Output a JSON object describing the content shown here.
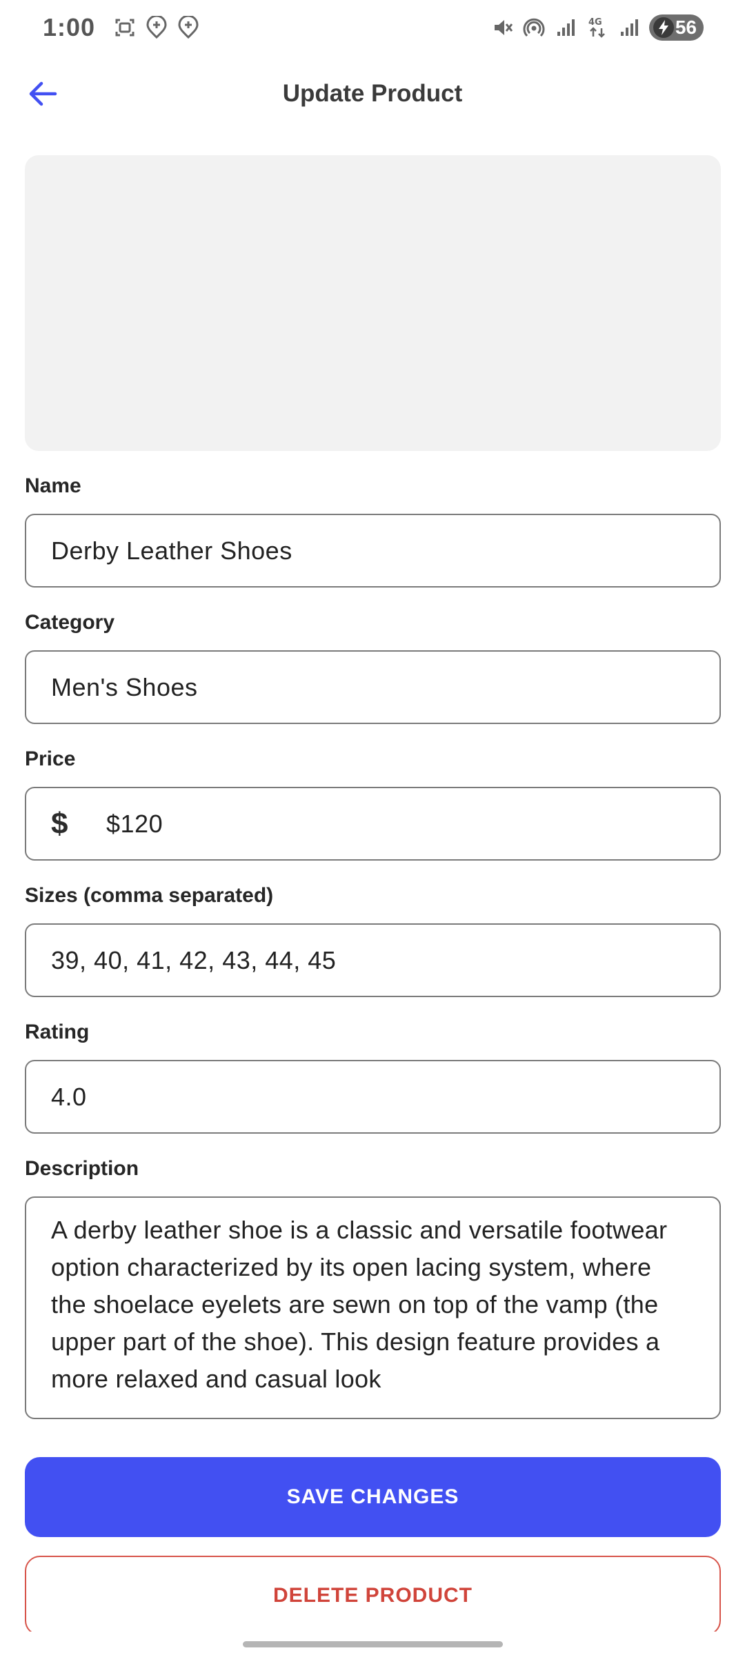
{
  "status_bar": {
    "time": "1:00",
    "battery_level": "56",
    "left_icons": [
      "screenshot-icon",
      "location-pin-plus-icon",
      "location-pin-plus-icon"
    ],
    "right_icons": [
      "mute-icon",
      "hotspot-icon",
      "signal-icon",
      "network-4g-icon",
      "signal-icon"
    ]
  },
  "app_bar": {
    "title": "Update Product",
    "back_icon": "arrow-left-icon"
  },
  "form": {
    "name": {
      "label": "Name",
      "value": "Derby Leather Shoes"
    },
    "category": {
      "label": "Category",
      "value": "Men's Shoes"
    },
    "price": {
      "label": "Price",
      "prefix": "$",
      "value": "$120"
    },
    "sizes": {
      "label": "Sizes (comma separated)",
      "value": "39, 40, 41, 42, 43, 44, 45"
    },
    "rating": {
      "label": "Rating",
      "value": "4.0"
    },
    "description": {
      "label": "Description",
      "value": "A derby leather shoe is a classic and versatile footwear option characterized by its open lacing system, where the shoelace eyelets are sewn on top of the vamp (the upper part of the shoe). This design feature provides a more relaxed and casual look"
    }
  },
  "actions": {
    "save_label": "SAVE CHANGES",
    "delete_label": "DELETE PRODUCT"
  },
  "colors": {
    "accent": "#4250f2",
    "danger": "#d0443a",
    "placeholder_bg": "#f2f2f2"
  }
}
